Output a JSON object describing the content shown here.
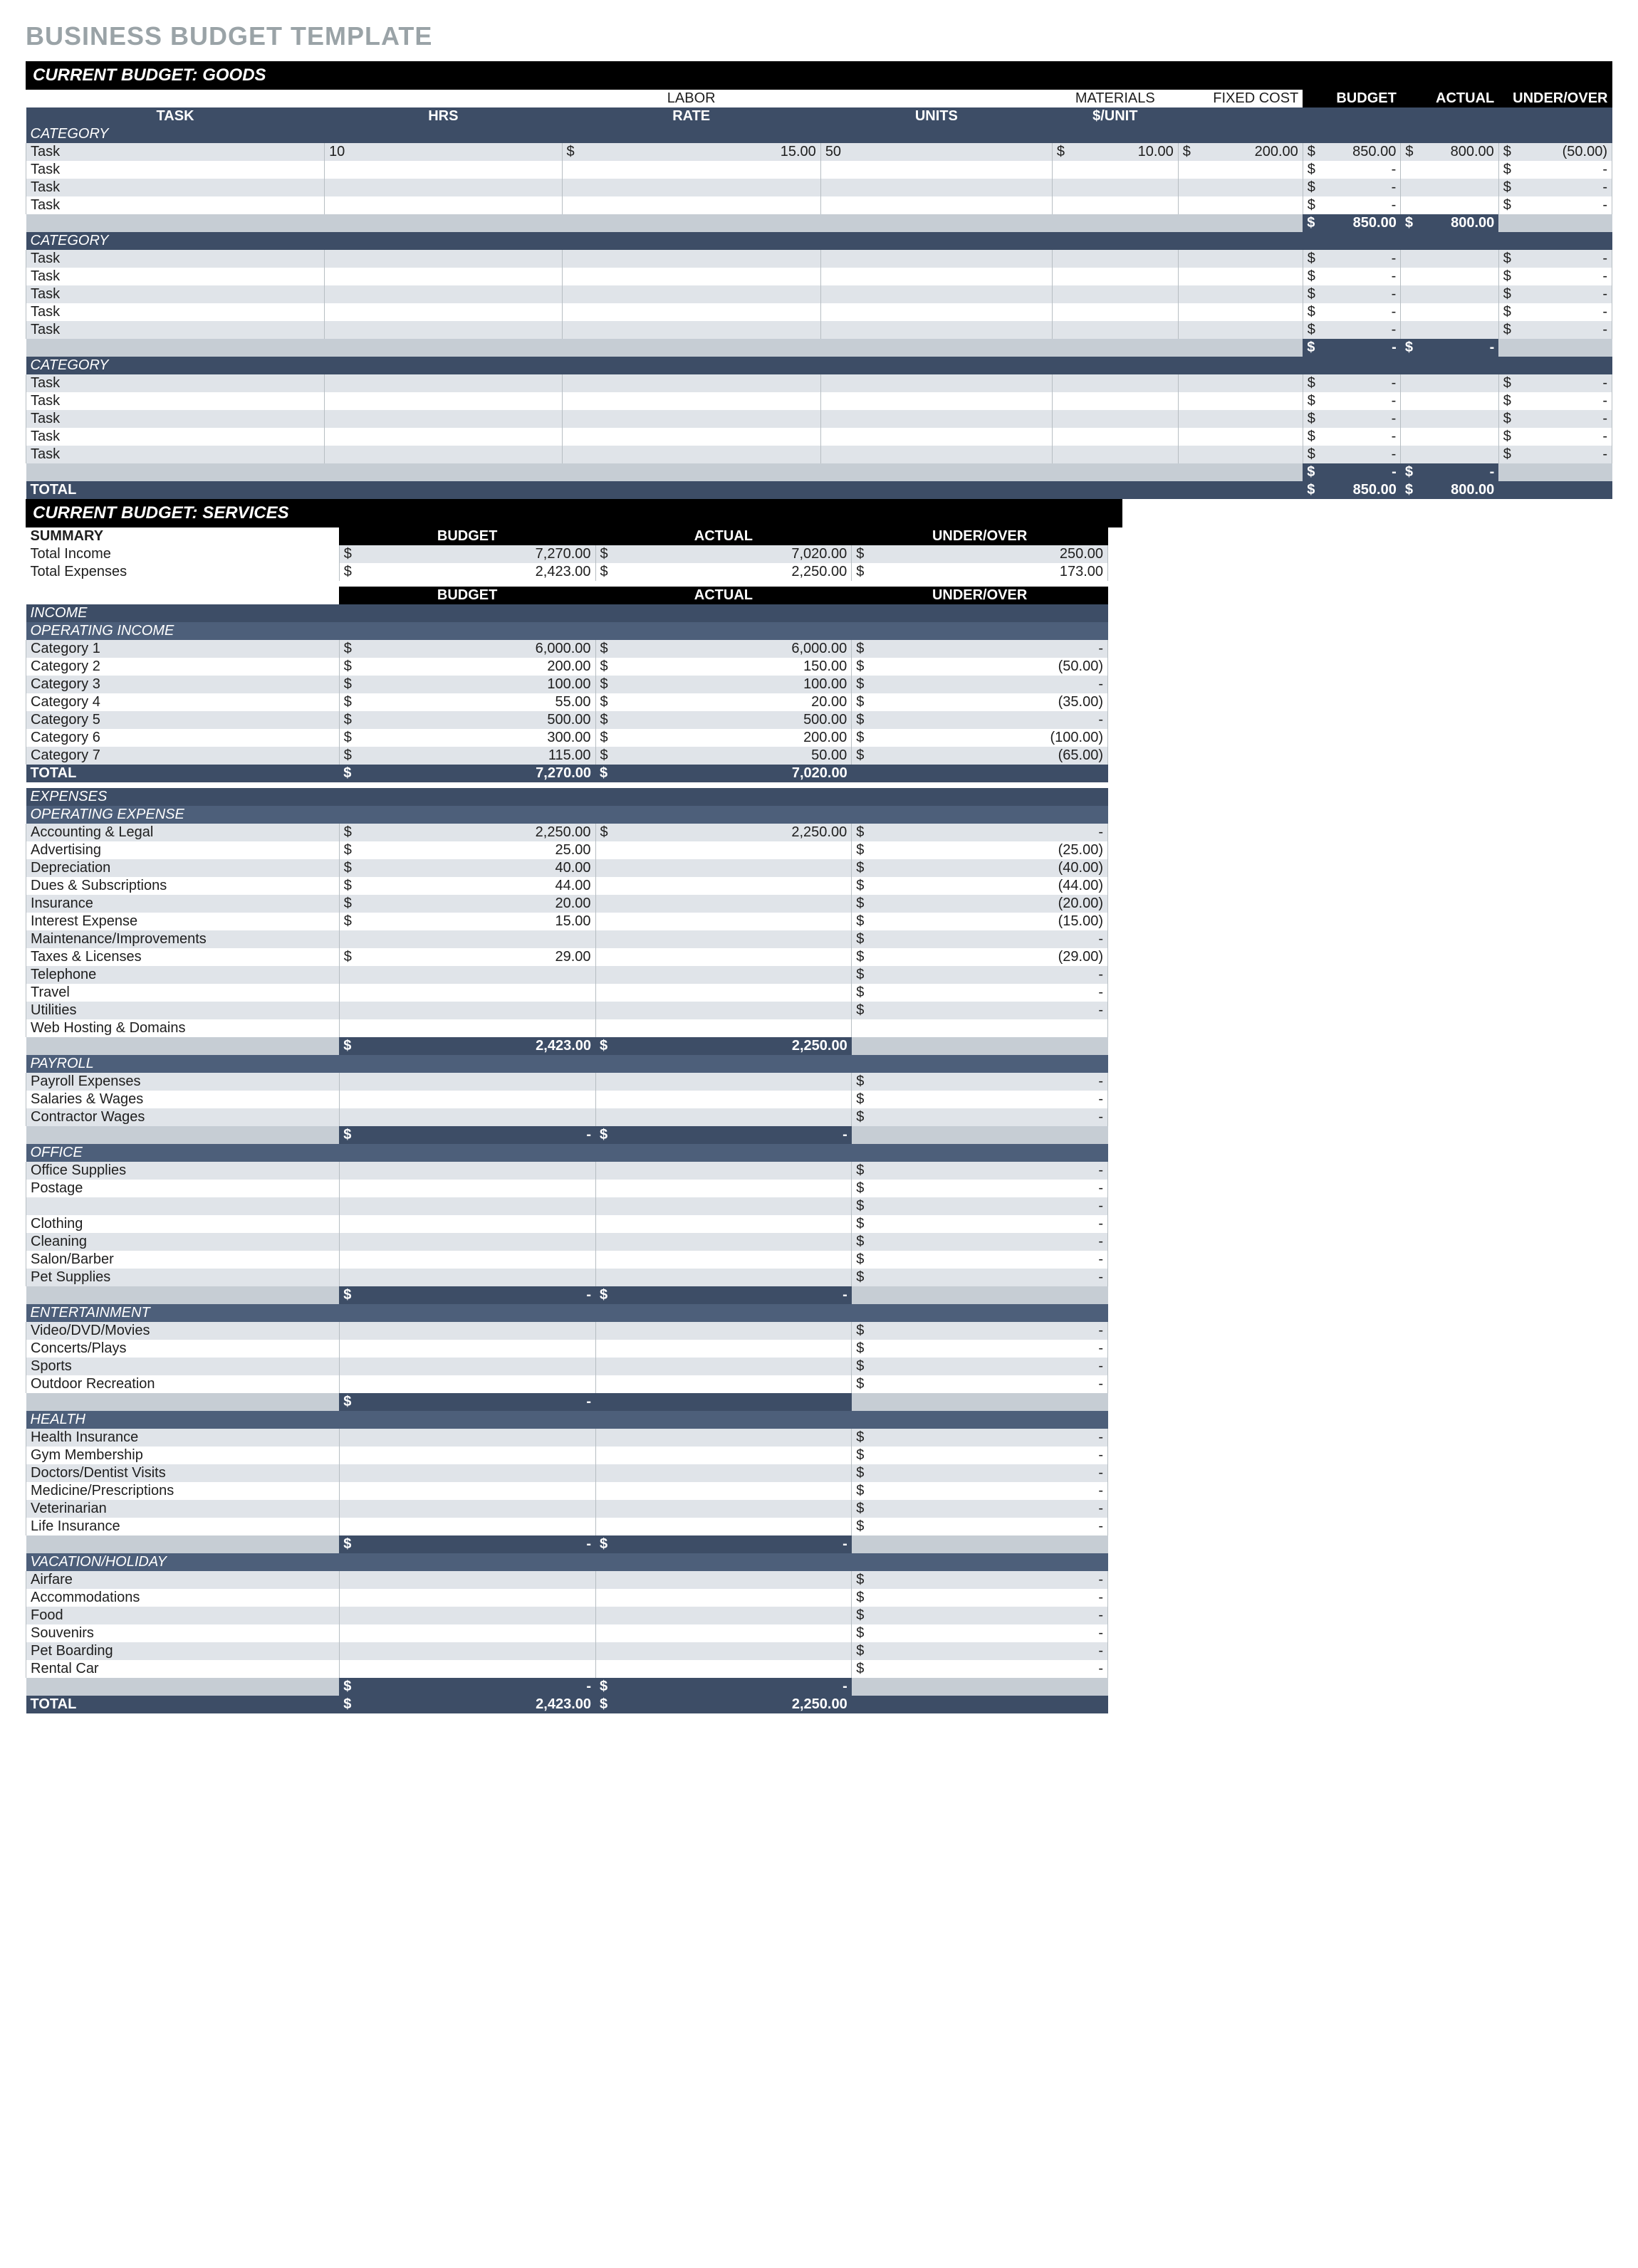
{
  "title": "BUSINESS BUDGET TEMPLATE",
  "section_goods": "CURRENT BUDGET: GOODS",
  "section_services": "CURRENT BUDGET: SERVICES",
  "goods": {
    "superheaders": {
      "labor": "LABOR",
      "materials": "MATERIALS",
      "fixed": "FIXED COST",
      "budget": "BUDGET",
      "actual": "ACTUAL",
      "uo": "UNDER/OVER"
    },
    "headers": {
      "task": "TASK",
      "hrs": "HRS",
      "rate": "RATE",
      "units": "UNITS",
      "unit_price": "$/UNIT"
    },
    "category_label": "CATEGORY",
    "task_label": "Task",
    "total_label": "TOTAL",
    "groups": [
      {
        "rows": [
          {
            "task": "Task",
            "hrs": "10",
            "rate": "15.00",
            "units": "50",
            "unit_price": "10.00",
            "fixed": "200.00",
            "budget": "850.00",
            "actual": "800.00",
            "uo": "(50.00)"
          },
          {
            "task": "Task",
            "hrs": "",
            "rate": "",
            "units": "",
            "unit_price": "",
            "fixed": "",
            "budget": "-",
            "actual": "",
            "uo": "-"
          },
          {
            "task": "Task",
            "hrs": "",
            "rate": "",
            "units": "",
            "unit_price": "",
            "fixed": "",
            "budget": "-",
            "actual": "",
            "uo": "-"
          },
          {
            "task": "Task",
            "hrs": "",
            "rate": "",
            "units": "",
            "unit_price": "",
            "fixed": "",
            "budget": "-",
            "actual": "",
            "uo": "-"
          }
        ],
        "subtotal": {
          "budget": "850.00",
          "actual": "800.00"
        }
      },
      {
        "rows": [
          {
            "task": "Task",
            "hrs": "",
            "rate": "",
            "units": "",
            "unit_price": "",
            "fixed": "",
            "budget": "-",
            "actual": "",
            "uo": "-"
          },
          {
            "task": "Task",
            "hrs": "",
            "rate": "",
            "units": "",
            "unit_price": "",
            "fixed": "",
            "budget": "-",
            "actual": "",
            "uo": "-"
          },
          {
            "task": "Task",
            "hrs": "",
            "rate": "",
            "units": "",
            "unit_price": "",
            "fixed": "",
            "budget": "-",
            "actual": "",
            "uo": "-"
          },
          {
            "task": "Task",
            "hrs": "",
            "rate": "",
            "units": "",
            "unit_price": "",
            "fixed": "",
            "budget": "-",
            "actual": "",
            "uo": "-"
          },
          {
            "task": "Task",
            "hrs": "",
            "rate": "",
            "units": "",
            "unit_price": "",
            "fixed": "",
            "budget": "-",
            "actual": "",
            "uo": "-"
          }
        ],
        "subtotal": {
          "budget": "-",
          "actual": "-"
        }
      },
      {
        "rows": [
          {
            "task": "Task",
            "hrs": "",
            "rate": "",
            "units": "",
            "unit_price": "",
            "fixed": "",
            "budget": "-",
            "actual": "",
            "uo": "-"
          },
          {
            "task": "Task",
            "hrs": "",
            "rate": "",
            "units": "",
            "unit_price": "",
            "fixed": "",
            "budget": "-",
            "actual": "",
            "uo": "-"
          },
          {
            "task": "Task",
            "hrs": "",
            "rate": "",
            "units": "",
            "unit_price": "",
            "fixed": "",
            "budget": "-",
            "actual": "",
            "uo": "-"
          },
          {
            "task": "Task",
            "hrs": "",
            "rate": "",
            "units": "",
            "unit_price": "",
            "fixed": "",
            "budget": "-",
            "actual": "",
            "uo": "-"
          },
          {
            "task": "Task",
            "hrs": "",
            "rate": "",
            "units": "",
            "unit_price": "",
            "fixed": "",
            "budget": "-",
            "actual": "",
            "uo": "-"
          }
        ],
        "subtotal": {
          "budget": "-",
          "actual": "-"
        }
      }
    ],
    "grand_total": {
      "budget": "850.00",
      "actual": "800.00"
    }
  },
  "services": {
    "summary_label": "SUMMARY",
    "cols": {
      "budget": "BUDGET",
      "actual": "ACTUAL",
      "uo": "UNDER/OVER"
    },
    "summary": [
      {
        "label": "Total Income",
        "budget": "7,270.00",
        "actual": "7,020.00",
        "uo": "250.00"
      },
      {
        "label": "Total Expenses",
        "budget": "2,423.00",
        "actual": "2,250.00",
        "uo": "173.00"
      }
    ],
    "income_label": "INCOME",
    "expenses_label": "EXPENSES",
    "total_label": "TOTAL",
    "income": {
      "sub_label": "OPERATING INCOME",
      "rows": [
        {
          "label": "Category 1",
          "budget": "6,000.00",
          "actual": "6,000.00",
          "uo": "-"
        },
        {
          "label": "Category 2",
          "budget": "200.00",
          "actual": "150.00",
          "uo": "(50.00)"
        },
        {
          "label": "Category 3",
          "budget": "100.00",
          "actual": "100.00",
          "uo": "-"
        },
        {
          "label": "Category 4",
          "budget": "55.00",
          "actual": "20.00",
          "uo": "(35.00)"
        },
        {
          "label": "Category 5",
          "budget": "500.00",
          "actual": "500.00",
          "uo": "-"
        },
        {
          "label": "Category 6",
          "budget": "300.00",
          "actual": "200.00",
          "uo": "(100.00)"
        },
        {
          "label": "Category 7",
          "budget": "115.00",
          "actual": "50.00",
          "uo": "(65.00)"
        }
      ],
      "total": {
        "budget": "7,270.00",
        "actual": "7,020.00"
      }
    },
    "expenses": [
      {
        "label": "OPERATING EXPENSE",
        "rows": [
          {
            "label": "Accounting & Legal",
            "budget": "2,250.00",
            "actual": "2,250.00",
            "uo": "-"
          },
          {
            "label": "Advertising",
            "budget": "25.00",
            "actual": "",
            "uo": "(25.00)"
          },
          {
            "label": "Depreciation",
            "budget": "40.00",
            "actual": "",
            "uo": "(40.00)"
          },
          {
            "label": "Dues & Subscriptions",
            "budget": "44.00",
            "actual": "",
            "uo": "(44.00)"
          },
          {
            "label": "Insurance",
            "budget": "20.00",
            "actual": "",
            "uo": "(20.00)"
          },
          {
            "label": "Interest Expense",
            "budget": "15.00",
            "actual": "",
            "uo": "(15.00)"
          },
          {
            "label": "Maintenance/Improvements",
            "budget": "",
            "actual": "",
            "uo": "-"
          },
          {
            "label": "Taxes & Licenses",
            "budget": "29.00",
            "actual": "",
            "uo": "(29.00)"
          },
          {
            "label": "Telephone",
            "budget": "",
            "actual": "",
            "uo": "-"
          },
          {
            "label": "Travel",
            "budget": "",
            "actual": "",
            "uo": "-"
          },
          {
            "label": "Utilities",
            "budget": "",
            "actual": "",
            "uo": "-"
          },
          {
            "label": "Web Hosting & Domains",
            "budget": "",
            "actual": "",
            "uo": ""
          }
        ],
        "subtotal": {
          "budget": "2,423.00",
          "actual": "2,250.00"
        }
      },
      {
        "label": "PAYROLL",
        "rows": [
          {
            "label": "Payroll Expenses",
            "budget": "",
            "actual": "",
            "uo": "-"
          },
          {
            "label": "Salaries & Wages",
            "budget": "",
            "actual": "",
            "uo": "-"
          },
          {
            "label": "Contractor Wages",
            "budget": "",
            "actual": "",
            "uo": "-"
          }
        ],
        "subtotal": {
          "budget": "-",
          "actual": "-"
        }
      },
      {
        "label": "OFFICE",
        "rows": [
          {
            "label": "Office Supplies",
            "budget": "",
            "actual": "",
            "uo": "-"
          },
          {
            "label": "Postage",
            "budget": "",
            "actual": "",
            "uo": "-"
          },
          {
            "label": "",
            "budget": "",
            "actual": "",
            "uo": "-"
          },
          {
            "label": "Clothing",
            "budget": "",
            "actual": "",
            "uo": "-"
          },
          {
            "label": "Cleaning",
            "budget": "",
            "actual": "",
            "uo": "-"
          },
          {
            "label": "Salon/Barber",
            "budget": "",
            "actual": "",
            "uo": "-"
          },
          {
            "label": "Pet Supplies",
            "budget": "",
            "actual": "",
            "uo": "-"
          }
        ],
        "subtotal": {
          "budget": "-",
          "actual": "-"
        }
      },
      {
        "label": "ENTERTAINMENT",
        "rows": [
          {
            "label": "Video/DVD/Movies",
            "budget": "",
            "actual": "",
            "uo": "-"
          },
          {
            "label": "Concerts/Plays",
            "budget": "",
            "actual": "",
            "uo": "-"
          },
          {
            "label": "Sports",
            "budget": "",
            "actual": "",
            "uo": "-"
          },
          {
            "label": "Outdoor Recreation",
            "budget": "",
            "actual": "",
            "uo": "-"
          }
        ],
        "subtotal": {
          "budget": "-",
          "actual": ""
        }
      },
      {
        "label": "HEALTH",
        "rows": [
          {
            "label": "Health Insurance",
            "budget": "",
            "actual": "",
            "uo": "-"
          },
          {
            "label": "Gym Membership",
            "budget": "",
            "actual": "",
            "uo": "-"
          },
          {
            "label": "Doctors/Dentist Visits",
            "budget": "",
            "actual": "",
            "uo": "-"
          },
          {
            "label": "Medicine/Prescriptions",
            "budget": "",
            "actual": "",
            "uo": "-"
          },
          {
            "label": "Veterinarian",
            "budget": "",
            "actual": "",
            "uo": "-"
          },
          {
            "label": "Life Insurance",
            "budget": "",
            "actual": "",
            "uo": "-"
          }
        ],
        "subtotal": {
          "budget": "-",
          "actual": "-"
        }
      },
      {
        "label": "VACATION/HOLIDAY",
        "rows": [
          {
            "label": "Airfare",
            "budget": "",
            "actual": "",
            "uo": "-"
          },
          {
            "label": "Accommodations",
            "budget": "",
            "actual": "",
            "uo": "-"
          },
          {
            "label": "Food",
            "budget": "",
            "actual": "",
            "uo": "-"
          },
          {
            "label": "Souvenirs",
            "budget": "",
            "actual": "",
            "uo": "-"
          },
          {
            "label": "Pet Boarding",
            "budget": "",
            "actual": "",
            "uo": "-"
          },
          {
            "label": "Rental Car",
            "budget": "",
            "actual": "",
            "uo": "-"
          }
        ],
        "subtotal": {
          "budget": "-",
          "actual": "-"
        }
      }
    ],
    "grand_total": {
      "budget": "2,423.00",
      "actual": "2,250.00"
    }
  }
}
